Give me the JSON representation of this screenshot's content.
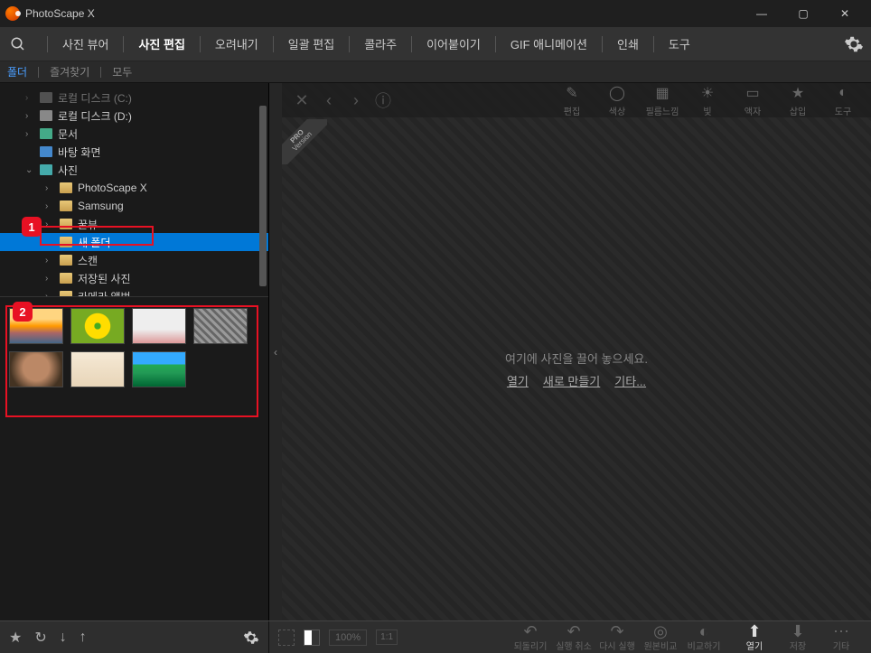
{
  "app": {
    "title": "PhotoScape X"
  },
  "win": {
    "min": "—",
    "max": "▢",
    "close": "✕"
  },
  "menu": {
    "items": [
      "사진 뷰어",
      "사진 편집",
      "오려내기",
      "일괄 편집",
      "콜라주",
      "이어붙이기",
      "GIF 애니메이션",
      "인쇄",
      "도구"
    ],
    "active_index": 1
  },
  "subtabs": {
    "items": [
      "폴더",
      "즐겨찾기",
      "모두"
    ],
    "active_index": 0
  },
  "tree": {
    "nodes": [
      {
        "label": "로컬 디스크 (C:)",
        "icon": "drive",
        "chevron": "›",
        "depth": 1,
        "dim": true
      },
      {
        "label": "로컬 디스크 (D:)",
        "icon": "drive",
        "chevron": "›",
        "depth": 1
      },
      {
        "label": "문서",
        "icon": "doc",
        "chevron": "›",
        "depth": 1
      },
      {
        "label": "바탕 화면",
        "icon": "desk",
        "chevron": "",
        "depth": 1
      },
      {
        "label": "사진",
        "icon": "pic",
        "chevron": "⌄",
        "depth": 1
      },
      {
        "label": "PhotoScape X",
        "icon": "folder",
        "chevron": "›",
        "depth": 2
      },
      {
        "label": "Samsung",
        "icon": "folder",
        "chevron": "›",
        "depth": 2
      },
      {
        "label": "꿀뷰",
        "icon": "folder",
        "chevron": "›",
        "depth": 2
      },
      {
        "label": "새 폴더",
        "icon": "folder",
        "chevron": "",
        "depth": 2,
        "selected": true
      },
      {
        "label": "스캔",
        "icon": "folder",
        "chevron": "›",
        "depth": 2
      },
      {
        "label": "저장된 사진",
        "icon": "folder",
        "chevron": "›",
        "depth": 2
      },
      {
        "label": "카메라 앨범",
        "icon": "folder",
        "chevron": "›",
        "depth": 2
      }
    ]
  },
  "callouts": {
    "one": "1",
    "two": "2"
  },
  "thumbs": [
    "sunset",
    "sunflower",
    "cats",
    "cat2",
    "lion",
    "pug",
    "mountain"
  ],
  "canvas": {
    "pro_line1": "PRO",
    "pro_line2": "Version",
    "drophint": "여기에 사진을 끌어 놓으세요.",
    "links": [
      "열기",
      "새로 만들기",
      "기타..."
    ],
    "tools": [
      {
        "label": "편집",
        "icon": "✎"
      },
      {
        "label": "색상",
        "icon": "◯"
      },
      {
        "label": "필름느낌",
        "icon": "▦"
      },
      {
        "label": "빛",
        "icon": "☀"
      },
      {
        "label": "액자",
        "icon": "▭"
      },
      {
        "label": "삽입",
        "icon": "★"
      },
      {
        "label": "도구",
        "icon": "◐"
      }
    ]
  },
  "bottom": {
    "zoom": "100%",
    "ratio": "1:1",
    "tools": [
      {
        "label": "되돌리기",
        "icon": "↶"
      },
      {
        "label": "실행 취소",
        "icon": "↶"
      },
      {
        "label": "다시 실행",
        "icon": "↷"
      },
      {
        "label": "원본비교",
        "icon": "◎"
      },
      {
        "label": "비교하기",
        "icon": "◐"
      }
    ],
    "actions": [
      {
        "label": "열기",
        "icon": "⬆",
        "active": true
      },
      {
        "label": "저장",
        "icon": "⬇"
      },
      {
        "label": "기타",
        "icon": "⋯"
      }
    ]
  }
}
